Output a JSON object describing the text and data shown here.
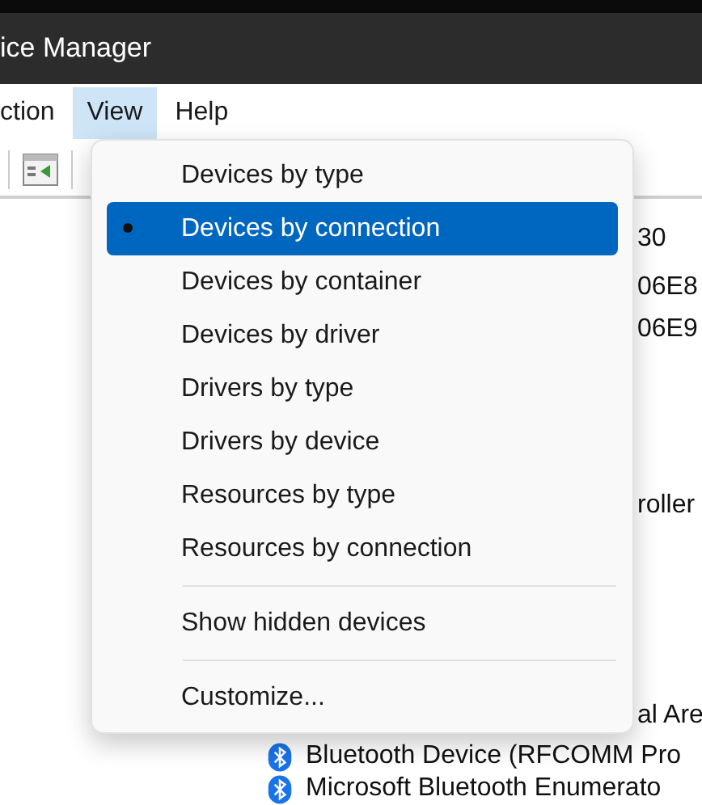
{
  "window": {
    "title": "ice Manager"
  },
  "menu_bar": [
    {
      "label": "ction",
      "selected": false
    },
    {
      "label": "View",
      "selected": true
    },
    {
      "label": "Help",
      "selected": false
    }
  ],
  "view_menu": {
    "items": [
      {
        "label": "Devices by type",
        "selected": false
      },
      {
        "label": "Devices by connection",
        "selected": true
      },
      {
        "label": "Devices by container",
        "selected": false
      },
      {
        "label": "Devices by driver",
        "selected": false
      },
      {
        "label": "Drivers by type",
        "selected": false
      },
      {
        "label": "Drivers by device",
        "selected": false
      },
      {
        "label": "Resources by type",
        "selected": false
      },
      {
        "label": "Resources by connection",
        "selected": false
      },
      {
        "label": "Show hidden devices",
        "selected": false
      },
      {
        "label": "Customize...",
        "selected": false
      }
    ]
  },
  "tree": [
    {
      "label": "30",
      "kind": "text"
    },
    {
      "label": "06E8",
      "kind": "text"
    },
    {
      "label": "06E9",
      "kind": "text"
    },
    {
      "label": "roller",
      "kind": "text"
    },
    {
      "label": "al Are",
      "kind": "text"
    },
    {
      "label": "Bluetooth Device (RFCOMM Pro",
      "kind": "bluetooth"
    },
    {
      "label": "Microsoft Bluetooth Enumerato",
      "kind": "bluetooth"
    }
  ]
}
